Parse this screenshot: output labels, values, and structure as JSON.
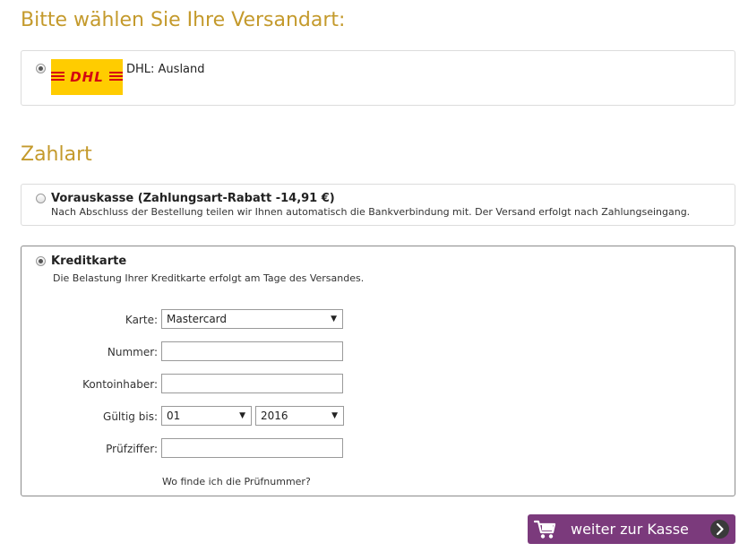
{
  "shipping": {
    "heading": "Bitte wählen Sie Ihre Versandart:",
    "logo_text": "DHL",
    "option_label": "DHL: Ausland"
  },
  "payment": {
    "heading": "Zahlart",
    "prepayment": {
      "title": "Vorauskasse (Zahlungsart-Rabatt -14,91 €)",
      "description": "Nach Abschluss der Bestellung teilen wir Ihnen automatisch die Bankverbindung mit. Der Versand erfolgt nach Zahlungseingang."
    },
    "credit_card": {
      "title": "Kreditkarte",
      "description": "Die Belastung Ihrer Kreditkarte erfolgt am Tage des Versandes.",
      "fields": {
        "card_label": "Karte:",
        "card_value": "Mastercard",
        "number_label": "Nummer:",
        "number_value": "",
        "holder_label": "Kontoinhaber:",
        "holder_value": "",
        "valid_label": "Gültig bis:",
        "month_value": "01",
        "year_value": "2016",
        "cvc_label": "Prüfziffer:",
        "cvc_value": ""
      },
      "help_link": "Wo finde ich die Prüfnummer?"
    }
  },
  "checkout_button": {
    "label": "weiter zur Kasse",
    "icon": "cart-icon",
    "arrow_icon": "chevron-right-icon"
  },
  "colors": {
    "heading": "#c49a2c",
    "button": "#7b3a7c",
    "dhl_yellow": "#ffcc00",
    "dhl_red": "#d40511"
  }
}
